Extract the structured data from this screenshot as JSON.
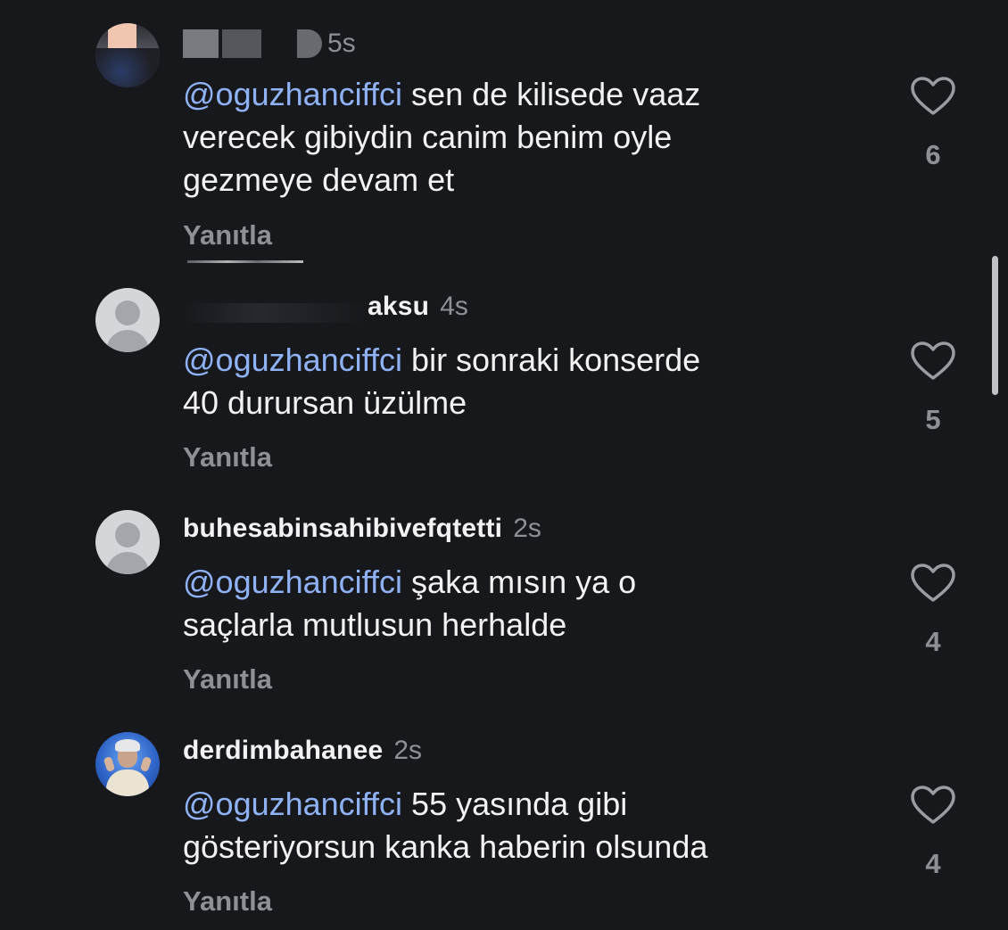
{
  "comments": [
    {
      "username": "",
      "time": "5s",
      "mention": "@oguzhanciffci",
      "text_lines": [
        "sen de kilisede vaaz",
        "verecek gibiydin canim benim oyle",
        "gezmeye devam et"
      ],
      "reply_label": "Yanıtla",
      "likes": "6"
    },
    {
      "username": "aksu",
      "time": "4s",
      "mention": "@oguzhanciffci",
      "text_lines": [
        "bir sonraki konserde",
        "40 durursan üzülme"
      ],
      "reply_label": "Yanıtla",
      "likes": "5"
    },
    {
      "username": "buhesabinsahibivefqtetti",
      "time": "2s",
      "mention": "@oguzhanciffci",
      "text_lines": [
        "şaka mısın ya o",
        "saçlarla mutlusun herhalde"
      ],
      "reply_label": "Yanıtla",
      "likes": "4"
    },
    {
      "username": "derdimbahanee",
      "time": "2s",
      "mention": "@oguzhanciffci",
      "text_lines": [
        "55 yasında gibi",
        "gösteriyorsun kanka haberin olsunda"
      ],
      "reply_label": "Yanıtla",
      "likes": "4"
    }
  ],
  "icons": {
    "like": "heart-outline-icon",
    "default_avatar": "person-placeholder-icon"
  },
  "colors": {
    "background": "#17181c",
    "mention": "#8fb2f5",
    "secondary_text": "#8e9096",
    "primary_text": "#f2f2f2"
  }
}
